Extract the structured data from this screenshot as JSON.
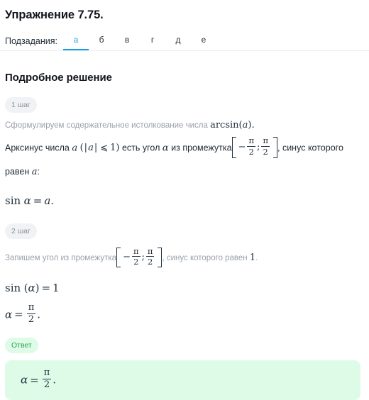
{
  "header": {
    "exercise_title": "Упражнение 7.75.",
    "subtasks_label": "Подзадания:",
    "tabs": [
      {
        "label": "а",
        "active": true
      },
      {
        "label": "б",
        "active": false
      },
      {
        "label": "в",
        "active": false
      },
      {
        "label": "г",
        "active": false
      },
      {
        "label": "д",
        "active": false
      },
      {
        "label": "е",
        "active": false
      }
    ],
    "active_tab": "а",
    "accent_color": "#14a0e6"
  },
  "solution": {
    "title": "Подробное решение",
    "steps": [
      {
        "badge": "1 шаг",
        "note": "Сформулируем содержательное истолкование числа arcsin(a).",
        "note_math": {
          "function": "arcsin",
          "argument": "a"
        },
        "paragraph": {
          "part1": "Арксинус числа",
          "variable": "a",
          "condition_open": "(",
          "condition_abs": "|a|",
          "condition_rel": "⩽",
          "condition_value": "1",
          "condition_close": ")",
          "part2": "есть угол",
          "angle": "α",
          "part3": "из промежутка",
          "interval_open": "[",
          "interval_left_sign": "−",
          "interval_left_num": "π",
          "interval_left_den": "2",
          "interval_sep": ";",
          "interval_right_num": "π",
          "interval_right_den": "2",
          "interval_close": "]",
          "part4": ", синус",
          "part5": "которого равен",
          "part6": "a",
          "part7": ":"
        },
        "formula": {
          "fn": "sin",
          "arg": "α",
          "eq": "=",
          "rhs": "a",
          "period": "."
        }
      },
      {
        "badge": "2 шаг",
        "note": {
          "part1": "Запишем угол из промежутка",
          "interval_open": "[",
          "interval_left_sign": "−",
          "interval_left_num": "π",
          "interval_left_den": "2",
          "interval_sep": ";",
          "interval_right_num": "π",
          "interval_right_den": "2",
          "interval_close": "]",
          "part2": ", синус которого равен",
          "value": "1",
          "part3": "."
        },
        "formula1": {
          "fn": "sin",
          "paren_open": "(",
          "arg": "α",
          "paren_close": ")",
          "eq": "=",
          "rhs": "1"
        },
        "formula2": {
          "lhs": "α",
          "eq": "=",
          "num": "π",
          "den": "2",
          "period": "."
        }
      }
    ],
    "answer": {
      "badge": "Ответ",
      "badge_color": "#28a251",
      "badge_bg": "#ddfbe7",
      "box_bg": "#ddfbe7",
      "formula": {
        "lhs": "α",
        "eq": "=",
        "num": "π",
        "den": "2",
        "period": "."
      }
    }
  }
}
